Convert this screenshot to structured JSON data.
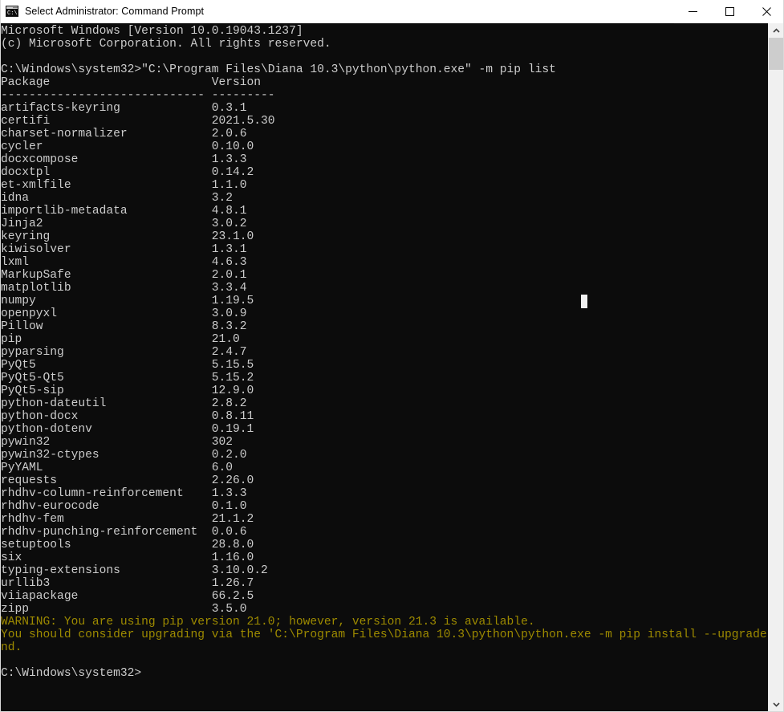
{
  "window": {
    "title": "Select Administrator: Command Prompt",
    "icon": "command-prompt-icon",
    "background_color": "#0c0c0c",
    "text_color": "#cccccc",
    "warning_color": "#9d8a00",
    "titlebar_color": "#ffffff",
    "controls": {
      "minimize": "minimize-button",
      "maximize": "maximize-button",
      "close": "close-button"
    }
  },
  "scrollbar": {
    "up_arrow": "scroll-up-arrow",
    "down_arrow": "scroll-down-arrow",
    "thumb": "scroll-thumb"
  },
  "console": {
    "header_lines": [
      "Microsoft Windows [Version 10.0.19043.1237]",
      "(c) Microsoft Corporation. All rights reserved.",
      "",
      "C:\\Windows\\system32>\"C:\\Program Files\\Diana 10.3\\python\\python.exe\" -m pip list"
    ],
    "table_header": {
      "name_column": "Package",
      "version_column": "Version",
      "name_rule": "-----------------------------",
      "version_rule": "---------"
    },
    "packages": [
      {
        "name": "artifacts-keyring",
        "version": "0.3.1"
      },
      {
        "name": "certifi",
        "version": "2021.5.30"
      },
      {
        "name": "charset-normalizer",
        "version": "2.0.6"
      },
      {
        "name": "cycler",
        "version": "0.10.0"
      },
      {
        "name": "docxcompose",
        "version": "1.3.3"
      },
      {
        "name": "docxtpl",
        "version": "0.14.2"
      },
      {
        "name": "et-xmlfile",
        "version": "1.1.0"
      },
      {
        "name": "idna",
        "version": "3.2"
      },
      {
        "name": "importlib-metadata",
        "version": "4.8.1"
      },
      {
        "name": "Jinja2",
        "version": "3.0.2"
      },
      {
        "name": "keyring",
        "version": "23.1.0"
      },
      {
        "name": "kiwisolver",
        "version": "1.3.1"
      },
      {
        "name": "lxml",
        "version": "4.6.3"
      },
      {
        "name": "MarkupSafe",
        "version": "2.0.1"
      },
      {
        "name": "matplotlib",
        "version": "3.3.4"
      },
      {
        "name": "numpy",
        "version": "1.19.5"
      },
      {
        "name": "openpyxl",
        "version": "3.0.9"
      },
      {
        "name": "Pillow",
        "version": "8.3.2"
      },
      {
        "name": "pip",
        "version": "21.0"
      },
      {
        "name": "pyparsing",
        "version": "2.4.7"
      },
      {
        "name": "PyQt5",
        "version": "5.15.5"
      },
      {
        "name": "PyQt5-Qt5",
        "version": "5.15.2"
      },
      {
        "name": "PyQt5-sip",
        "version": "12.9.0"
      },
      {
        "name": "python-dateutil",
        "version": "2.8.2"
      },
      {
        "name": "python-docx",
        "version": "0.8.11"
      },
      {
        "name": "python-dotenv",
        "version": "0.19.1"
      },
      {
        "name": "pywin32",
        "version": "302"
      },
      {
        "name": "pywin32-ctypes",
        "version": "0.2.0"
      },
      {
        "name": "PyYAML",
        "version": "6.0"
      },
      {
        "name": "requests",
        "version": "2.26.0"
      },
      {
        "name": "rhdhv-column-reinforcement",
        "version": "1.3.3"
      },
      {
        "name": "rhdhv-eurocode",
        "version": "0.1.0"
      },
      {
        "name": "rhdhv-fem",
        "version": "21.1.2"
      },
      {
        "name": "rhdhv-punching-reinforcement",
        "version": "0.0.6"
      },
      {
        "name": "setuptools",
        "version": "28.8.0"
      },
      {
        "name": "six",
        "version": "1.16.0"
      },
      {
        "name": "typing-extensions",
        "version": "3.10.0.2"
      },
      {
        "name": "urllib3",
        "version": "1.26.7"
      },
      {
        "name": "viiapackage",
        "version": "66.2.5"
      },
      {
        "name": "zipp",
        "version": "3.5.0"
      }
    ],
    "warning_lines": [
      "WARNING: You are using pip version 21.0; however, version 21.3 is available.",
      "You should consider upgrading via the 'C:\\Program Files\\Diana 10.3\\python\\python.exe -m pip install --upgrade pip' comma",
      "nd."
    ],
    "final_prompt": "C:\\Windows\\system32>",
    "cursor": "text-cursor-block"
  }
}
